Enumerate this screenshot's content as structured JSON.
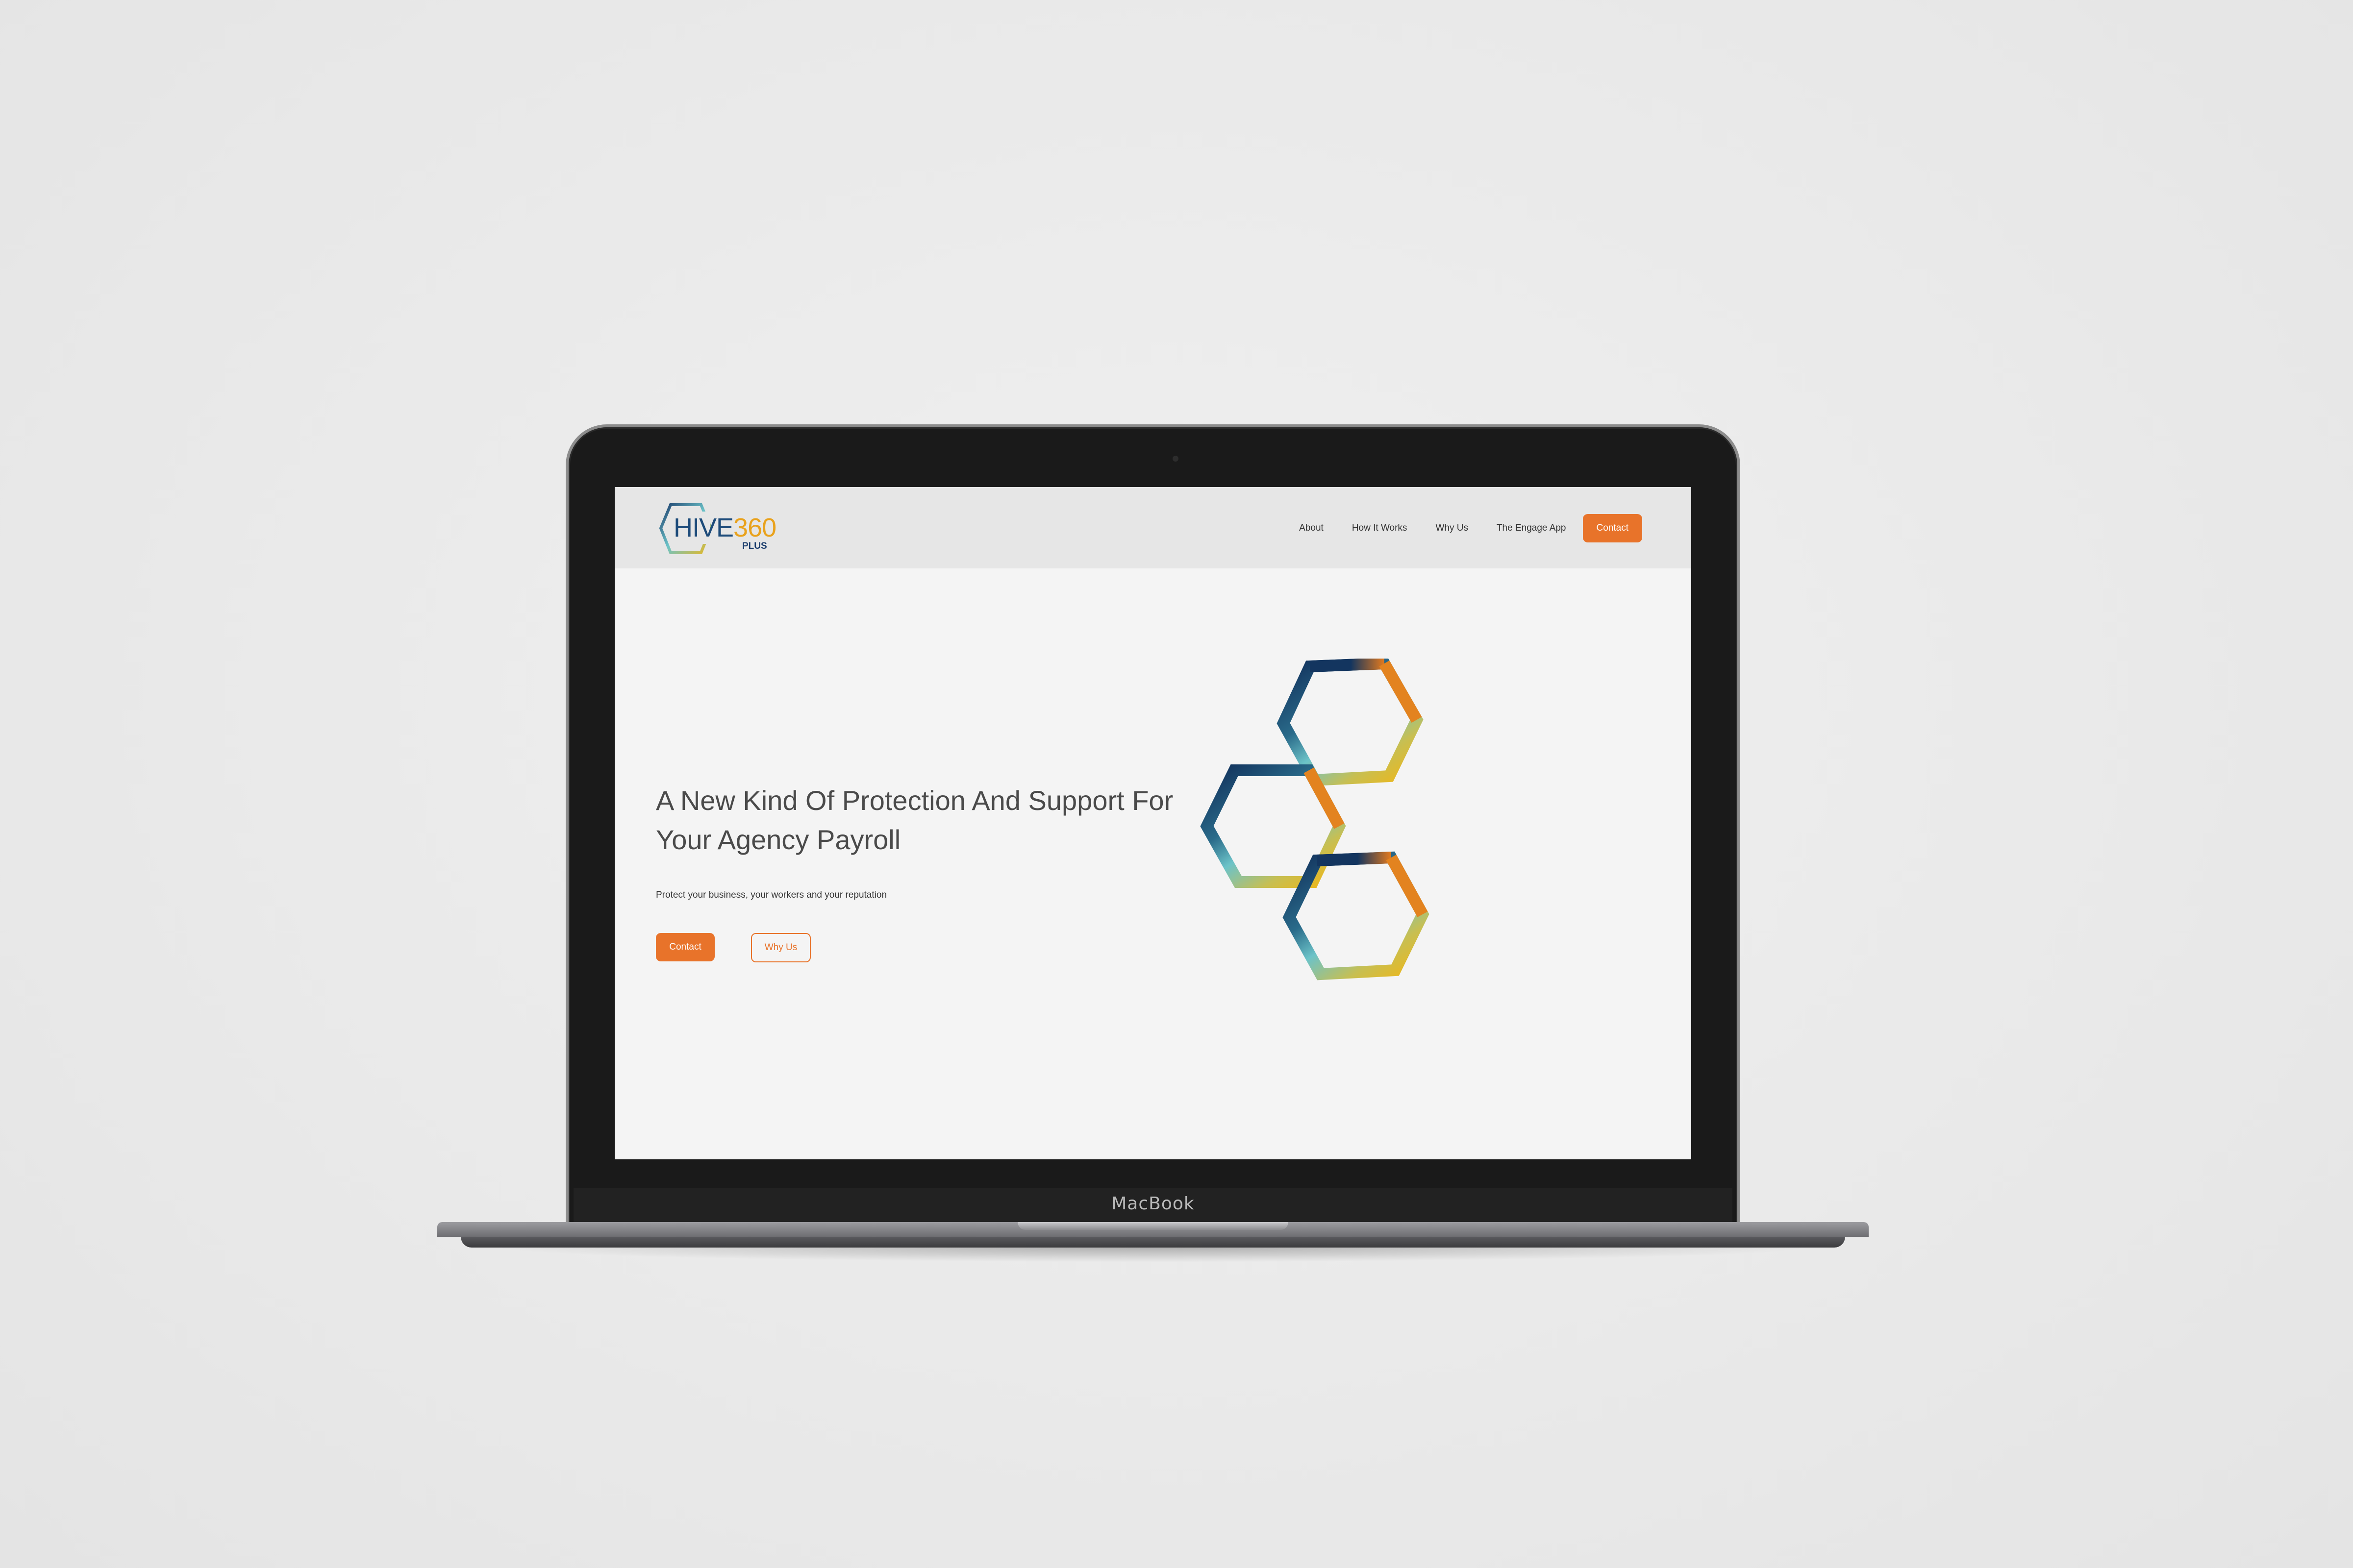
{
  "device": {
    "label": "MacBook"
  },
  "header": {
    "logo": {
      "hive": "HIVE",
      "number": "360",
      "plus": "PLUS"
    },
    "nav": {
      "about": "About",
      "how_it_works": "How It Works",
      "why_us": "Why Us",
      "engage_app": "The Engage App",
      "contact": "Contact"
    }
  },
  "hero": {
    "headline_line1": "A New Kind Of Protection And Support For",
    "headline_line2": "Your Agency Payroll",
    "subline": "Protect your business, your workers and your reputation",
    "primary_button": "Contact",
    "secondary_button": "Why Us"
  },
  "colors": {
    "accent": "#e8732a",
    "navy": "#1d3f6e",
    "teal": "#6cc3c8",
    "gold": "#eab820",
    "orange": "#e07a20"
  }
}
